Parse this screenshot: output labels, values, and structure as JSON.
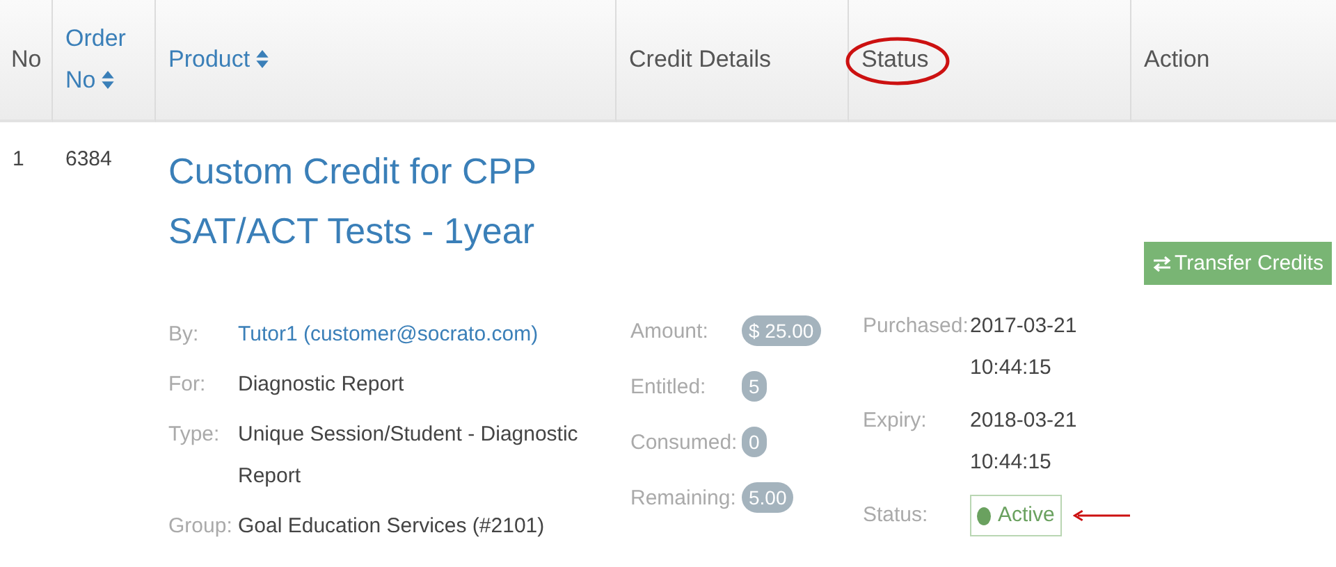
{
  "table": {
    "columns": [
      {
        "label": "No",
        "sortable": false,
        "circled": false
      },
      {
        "label": "Order No",
        "sortable": true,
        "circled": false
      },
      {
        "label": "Product",
        "sortable": true,
        "circled": false
      },
      {
        "label": "Credit Details",
        "sortable": false,
        "circled": false
      },
      {
        "label": "Status",
        "sortable": false,
        "circled": true
      },
      {
        "label": "Action",
        "sortable": false,
        "circled": false
      }
    ],
    "rows": [
      {
        "no": "1",
        "order_no": "6384",
        "title": "Custom Credit for CPP SAT/ACT Tests - 1year",
        "details": [
          {
            "label": "By:",
            "value": "Tutor1 (customer@socrato.com)",
            "kind": "link"
          },
          {
            "label": "For:",
            "value": "Diagnostic Report",
            "kind": "text"
          },
          {
            "label": "Type:",
            "value": "Unique Session/Student - Diagnostic Report",
            "kind": "text"
          },
          {
            "label": "Group:",
            "value": "Goal Education Services (#2101)",
            "kind": "text"
          }
        ],
        "credits": [
          {
            "label": "Amount:",
            "value": "$ 25.00"
          },
          {
            "label": "Entitled:",
            "value": "5"
          },
          {
            "label": "Consumed:",
            "value": "0"
          },
          {
            "label": "Remaining:",
            "value": "5.00"
          }
        ],
        "status_details": [
          {
            "label": "Purchased:",
            "value": "2017-03-21 10:44:15",
            "kind": "text",
            "pointed": false
          },
          {
            "label": "Expiry:",
            "value": "2018-03-21 10:44:15",
            "kind": "text",
            "pointed": false
          },
          {
            "label": "Status:",
            "value": "Active",
            "kind": "badge",
            "color": "#6aa15f",
            "pointed": true
          }
        ],
        "action": {
          "label": "Transfer Credits"
        }
      }
    ]
  }
}
